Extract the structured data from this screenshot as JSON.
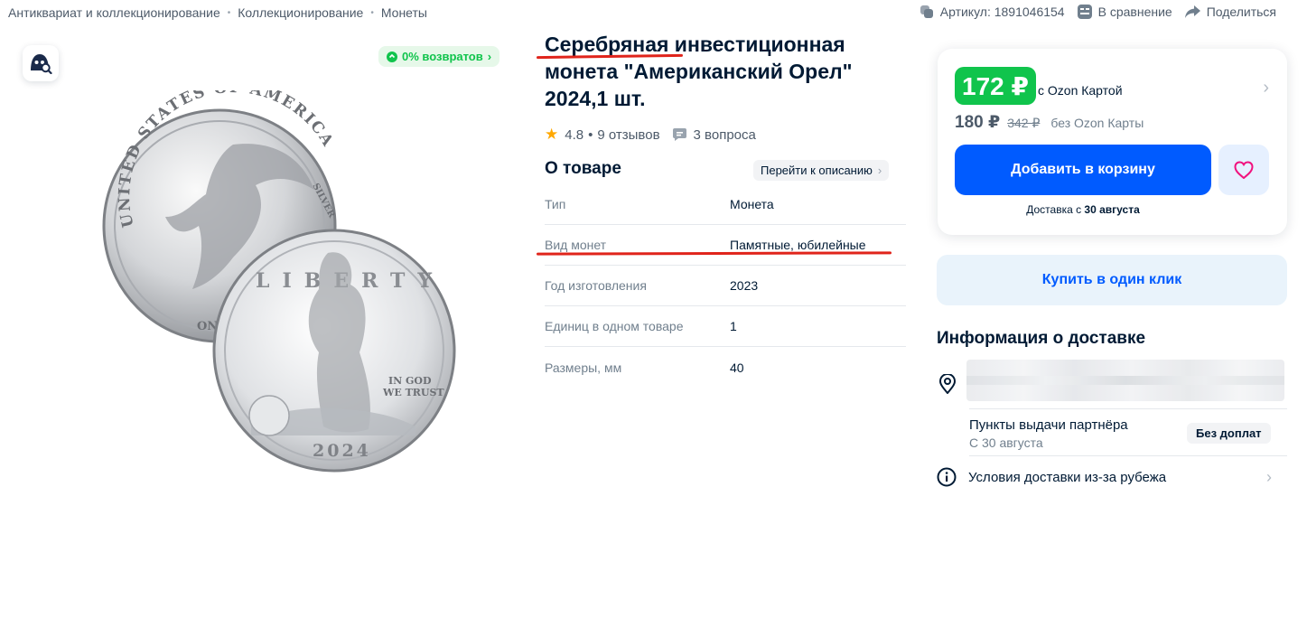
{
  "breadcrumbs": [
    "Антиквариат и коллекционирование",
    "Коллекционирование",
    "Монеты"
  ],
  "breadcrumb_sep": "•",
  "top_actions": {
    "article": "Артикул: 1891046154",
    "compare": "В сравнение",
    "share": "Поделиться"
  },
  "gallery": {
    "returns_badge": "0% возвратов",
    "coin_back": {
      "arc_text": "UNITED STATES OF AMERICA",
      "denomination": "ONE",
      "edge_text": "SILVER"
    },
    "coin_front": {
      "liberty": "LIBERTY",
      "motto_1": "IN GOD",
      "motto_2": "WE TRUST",
      "year": "2024"
    }
  },
  "product": {
    "title": "Серебряная инвестиционная монета \"Американский Орел\" 2024,1 шт.",
    "rating": "4.8",
    "reviews": "9 отзывов",
    "rating_sep": "•",
    "questions": "3 вопроса"
  },
  "about": {
    "heading": "О товаре",
    "goto_description": "Перейти к описанию",
    "specs": [
      {
        "key": "Тип",
        "value": "Монета"
      },
      {
        "key": "Вид монет",
        "value": "Памятные, юбилейные"
      },
      {
        "key": "Год изготовления",
        "value": "2023"
      },
      {
        "key": "Единиц в одном товаре",
        "value": "1"
      },
      {
        "key": "Размеры, мм",
        "value": "40"
      }
    ]
  },
  "pricing": {
    "ozon_card_price": "172 ₽",
    "ozon_card_label": "с Ozon Картой",
    "regular_price": "180 ₽",
    "old_price": "342 ₽",
    "regular_label": "без Ozon Карты",
    "add_to_cart": "Добавить в корзину",
    "delivery_prefix": "Доставка с ",
    "delivery_date": "30 августа"
  },
  "one_click": "Купить в один клик",
  "delivery_info": {
    "title": "Информация о доставке",
    "pickup_title": "Пункты выдачи партнёра",
    "pickup_date": "С 30 августа",
    "no_fee": "Без доплат",
    "abroad": "Условия доставки из-за рубежа"
  },
  "colors": {
    "price_green": "#10c44c",
    "cart_blue": "#005bff",
    "annotation_red": "#e0241b",
    "heart_pink": "#f1117e"
  }
}
